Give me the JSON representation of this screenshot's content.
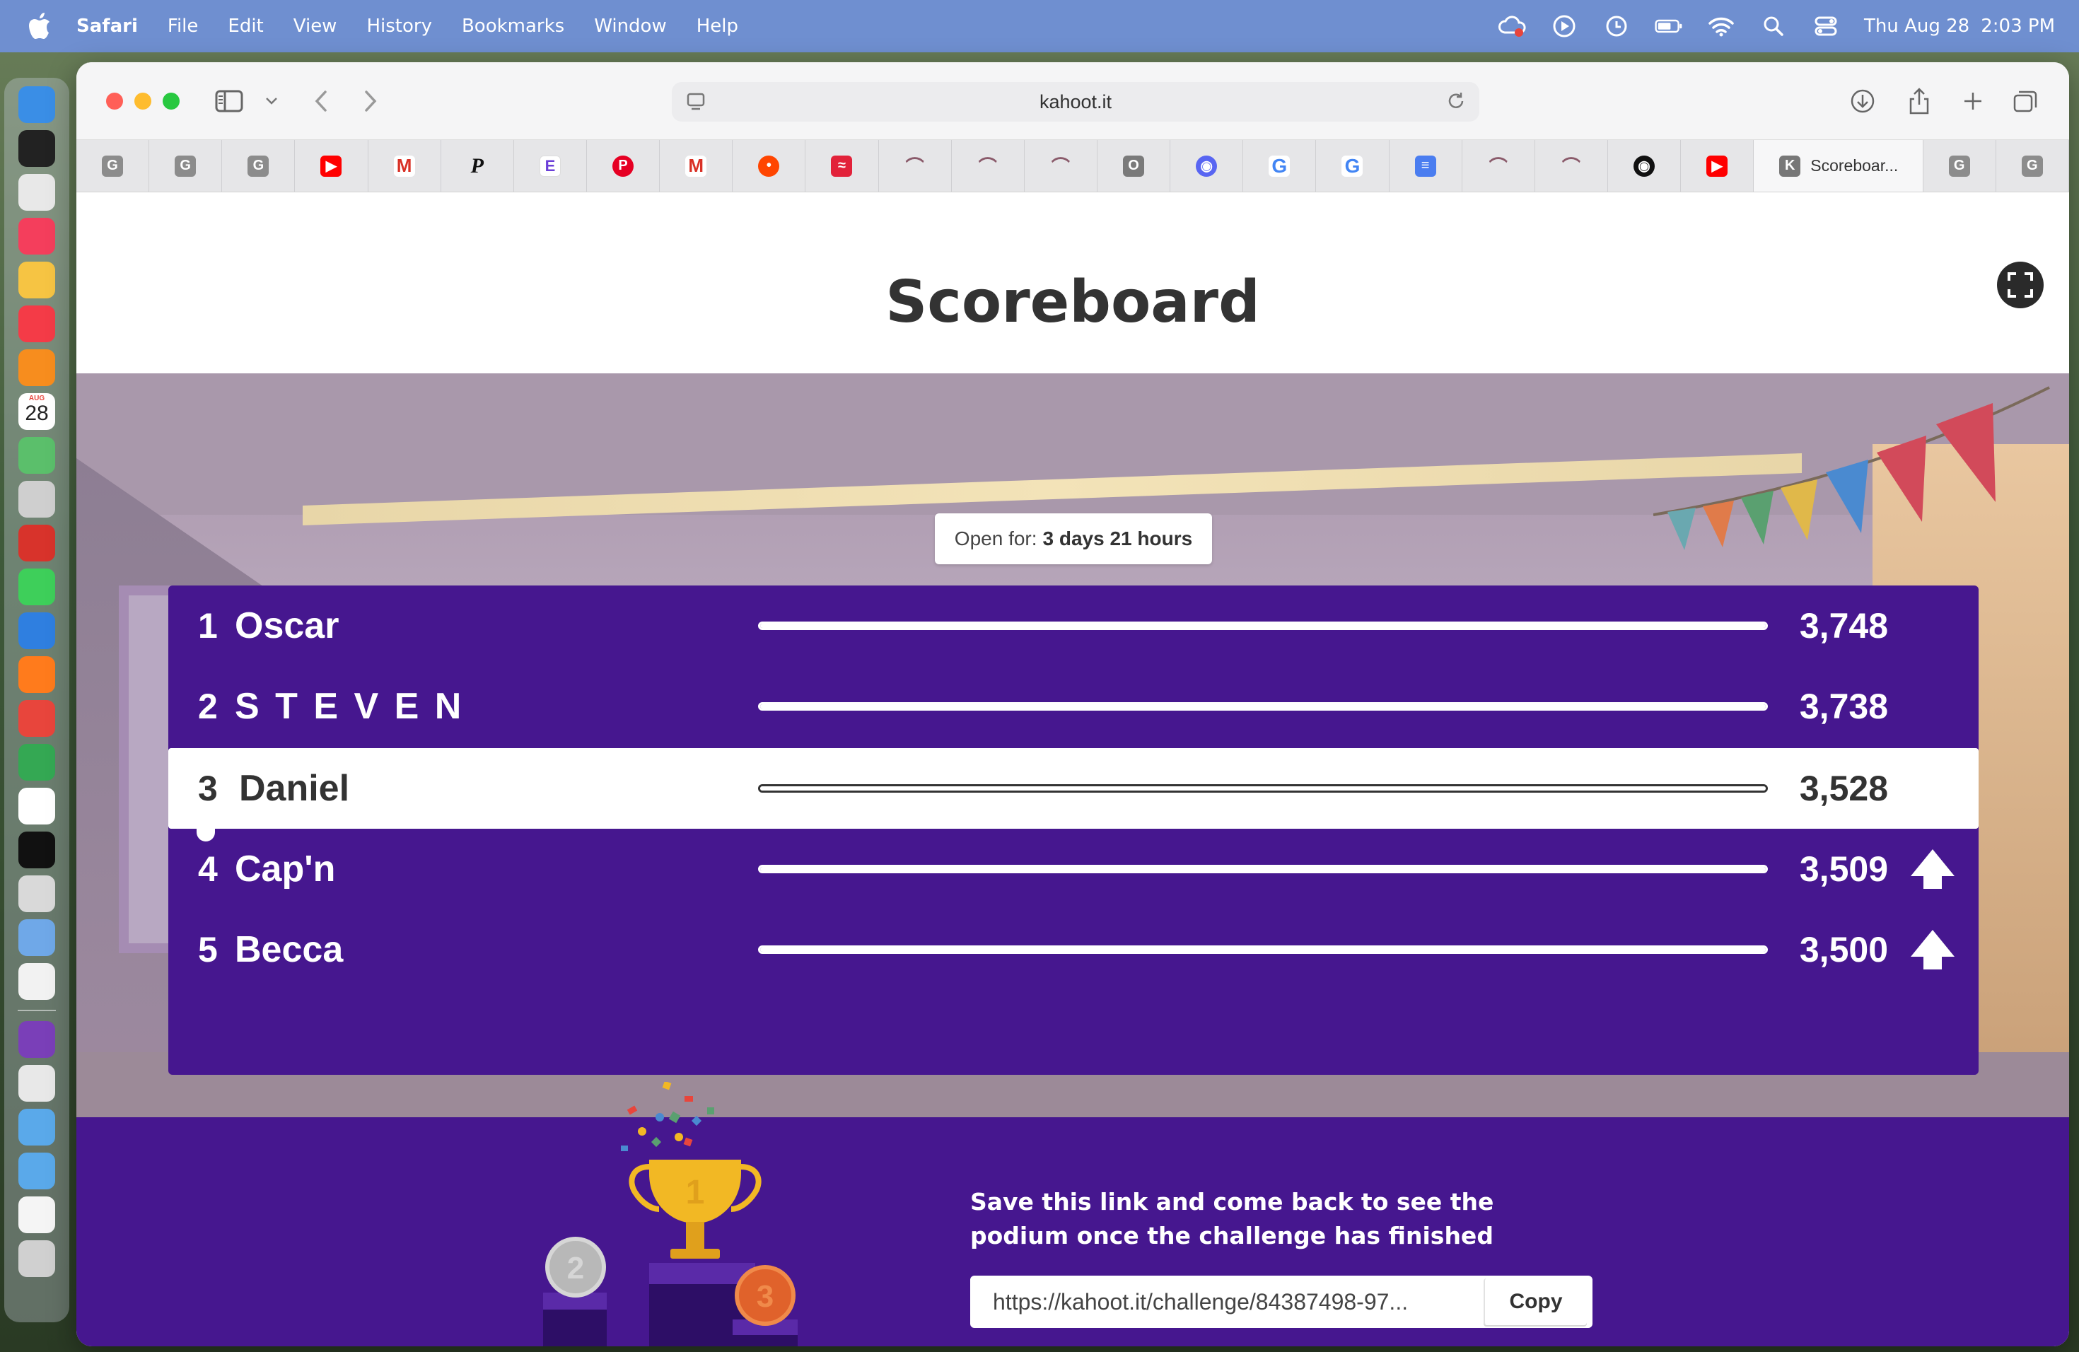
{
  "menubar": {
    "app_name": "Safari",
    "menus": [
      "File",
      "Edit",
      "View",
      "History",
      "Bookmarks",
      "Window",
      "Help"
    ],
    "clock_date": "Thu Aug 28",
    "clock_time": "2:03 PM"
  },
  "dock": {
    "apps": [
      {
        "icon": "finder-icon",
        "color": "#3a8ee6"
      },
      {
        "icon": "mission-control-icon",
        "color": "#222"
      },
      {
        "icon": "launchpad-icon",
        "color": "#e8e8e8"
      },
      {
        "icon": "music-icon",
        "color": "#f43e5c"
      },
      {
        "icon": "photos-icon",
        "color": "#f6c443"
      },
      {
        "icon": "news-icon",
        "color": "#f43b47"
      },
      {
        "icon": "books-icon",
        "color": "#f78d1e"
      },
      {
        "icon": "calendar-icon",
        "color": "#ffffff"
      },
      {
        "icon": "maps-icon",
        "color": "#5bbf6b"
      },
      {
        "icon": "help-icon",
        "color": "#cfcfcf"
      },
      {
        "icon": "photo-booth-icon",
        "color": "#d8332b"
      },
      {
        "icon": "facetime-icon",
        "color": "#3ecf5a"
      },
      {
        "icon": "safari-icon",
        "color": "#2f7fe0"
      },
      {
        "icon": "firefox-icon",
        "color": "#ff7b1c"
      },
      {
        "icon": "chrome-icon",
        "color": "#e8453c"
      },
      {
        "icon": "chrome-alt-icon",
        "color": "#34a853"
      },
      {
        "icon": "freeform-icon",
        "color": "#ffffff"
      },
      {
        "icon": "apple-tv-icon",
        "color": "#111111"
      },
      {
        "icon": "ipad-icon",
        "color": "#d9d9d9"
      },
      {
        "icon": "preview-icon",
        "color": "#6fa8e8"
      },
      {
        "icon": "textedit-icon",
        "color": "#f2f2f2"
      },
      {
        "icon": "github-desktop-icon",
        "color": "#7a3fb8"
      },
      {
        "icon": "documents-icon",
        "color": "#e8e8e8"
      },
      {
        "icon": "applications-folder-icon",
        "color": "#5aa9ea"
      },
      {
        "icon": "downloads-folder-icon",
        "color": "#5aa9ea"
      },
      {
        "icon": "file-icon",
        "color": "#f5f5f5"
      },
      {
        "icon": "trash-icon",
        "color": "#d0d0d0"
      }
    ],
    "calendar_month": "AUG",
    "calendar_day": "28"
  },
  "browser": {
    "address": "kahoot.it",
    "tabs": [
      {
        "icon": "g-favicon",
        "letter": "G",
        "kind": "fav-g"
      },
      {
        "icon": "g-favicon",
        "letter": "G",
        "kind": "fav-g"
      },
      {
        "icon": "g-favicon",
        "letter": "G",
        "kind": "fav-g"
      },
      {
        "icon": "youtube-icon",
        "letter": "▶",
        "kind": "fav-yt"
      },
      {
        "icon": "gmail-icon",
        "letter": "M",
        "kind": "fav-gm"
      },
      {
        "icon": "p-favicon",
        "letter": "P",
        "kind": "fav-p"
      },
      {
        "icon": "e-favicon",
        "letter": "E",
        "kind": "fav-e"
      },
      {
        "icon": "pinterest-icon",
        "letter": "P",
        "kind": "fav-pin"
      },
      {
        "icon": "gmail-icon",
        "letter": "M",
        "kind": "fav-gm"
      },
      {
        "icon": "reddit-icon",
        "letter": "•",
        "kind": "fav-reddit"
      },
      {
        "icon": "red-app-icon",
        "letter": "≈",
        "kind": "fav-red"
      },
      {
        "icon": "arc-icon",
        "letter": "⌒",
        "kind": "fav-arc"
      },
      {
        "icon": "arc-icon",
        "letter": "⌒",
        "kind": "fav-arc"
      },
      {
        "icon": "arc-icon",
        "letter": "⌒",
        "kind": "fav-arc"
      },
      {
        "icon": "o-favicon",
        "letter": "O",
        "kind": "fav-o"
      },
      {
        "icon": "discord-icon",
        "letter": "◉",
        "kind": "fav-discord"
      },
      {
        "icon": "google-icon",
        "letter": "G",
        "kind": "fav-google"
      },
      {
        "icon": "google-icon",
        "letter": "G",
        "kind": "fav-google"
      },
      {
        "icon": "google-docs-icon",
        "letter": "≡",
        "kind": "fav-docs"
      },
      {
        "icon": "arc-icon",
        "letter": "⌒",
        "kind": "fav-arc"
      },
      {
        "icon": "arc-icon",
        "letter": "⌒",
        "kind": "fav-arc"
      },
      {
        "icon": "github-icon",
        "letter": "◉",
        "kind": "fav-gh"
      },
      {
        "icon": "youtube-icon",
        "letter": "▶",
        "kind": "fav-yt"
      }
    ],
    "active_tab": {
      "icon": "kahoot-favicon",
      "letter": "K",
      "label": "Scoreboar..."
    },
    "trailing_tabs": [
      {
        "icon": "g-favicon",
        "letter": "G",
        "kind": "fav-g"
      },
      {
        "icon": "g-favicon",
        "letter": "G",
        "kind": "fav-g"
      }
    ]
  },
  "page": {
    "title": "Scoreboard",
    "open_for_label": "Open for:",
    "open_for_value": "3 days 21 hours",
    "scoreboard": [
      {
        "rank": "1",
        "name": "Oscar",
        "score": "3,748",
        "trend": "none",
        "highlight": false
      },
      {
        "rank": "2",
        "name": "S T E V E N",
        "score": "3,738",
        "trend": "none",
        "highlight": false
      },
      {
        "rank": "3",
        "name": "Daniel",
        "score": "3,528",
        "trend": "none",
        "highlight": true
      },
      {
        "rank": "4",
        "name": "Cap'n",
        "score": "3,509",
        "trend": "up",
        "highlight": false
      },
      {
        "rank": "5",
        "name": "Becca",
        "score": "3,500",
        "trend": "up",
        "highlight": false
      }
    ],
    "podium_labels": [
      "1",
      "2",
      "3"
    ],
    "footer_message": "Save this link and come back to see the podium once the challenge has finished",
    "challenge_link": "https://kahoot.it/challenge/84387498-97...",
    "copy_label": "Copy"
  },
  "colors": {
    "kahoot_purple": "#46178f",
    "menubar_blue": "#6f8fd0",
    "trophy_gold": "#f2b824",
    "bronze": "#e0622b",
    "silver": "#b8b8b8"
  }
}
